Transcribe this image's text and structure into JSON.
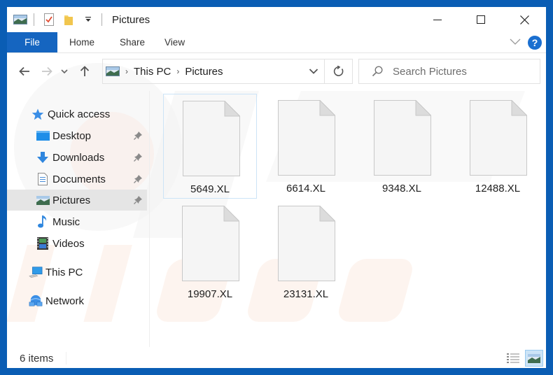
{
  "window": {
    "title": "Pictures",
    "controls": {
      "minimize": "minimize",
      "maximize": "maximize",
      "close": "close"
    }
  },
  "quick_access_toolbar": {
    "icons": [
      "pictures-icon",
      "properties-icon",
      "new-folder-icon",
      "customize-dropdown-icon"
    ]
  },
  "ribbon": {
    "tabs": [
      {
        "label": "File",
        "active": true
      },
      {
        "label": "Home"
      },
      {
        "label": "Share"
      },
      {
        "label": "View"
      }
    ],
    "expand_icon": "chevron-down-icon",
    "help_label": "?"
  },
  "navbar": {
    "back": "back-arrow-icon",
    "forward": "forward-arrow-icon",
    "recent": "recent-locations-icon",
    "up": "up-arrow-icon",
    "breadcrumb": [
      "This PC",
      "Pictures"
    ],
    "search_placeholder": "Search Pictures"
  },
  "sidebar": {
    "items": [
      {
        "label": "Quick access",
        "icon": "star-icon",
        "pinned": false,
        "selected": false
      },
      {
        "label": "Desktop",
        "icon": "desktop-icon",
        "pinned": true,
        "selected": false
      },
      {
        "label": "Downloads",
        "icon": "download-icon",
        "pinned": true,
        "selected": false
      },
      {
        "label": "Documents",
        "icon": "document-icon",
        "pinned": true,
        "selected": false
      },
      {
        "label": "Pictures",
        "icon": "pictures-icon",
        "pinned": true,
        "selected": true
      },
      {
        "label": "Music",
        "icon": "music-icon",
        "pinned": false,
        "selected": false
      },
      {
        "label": "Videos",
        "icon": "videos-icon",
        "pinned": false,
        "selected": false
      },
      {
        "label": "This PC",
        "icon": "computer-icon",
        "pinned": false,
        "selected": false
      },
      {
        "label": "Network",
        "icon": "network-icon",
        "pinned": false,
        "selected": false
      }
    ]
  },
  "files": [
    {
      "name": "5649.XL",
      "selected": true
    },
    {
      "name": "6614.XL",
      "selected": false
    },
    {
      "name": "9348.XL",
      "selected": false
    },
    {
      "name": "12488.XL",
      "selected": false
    },
    {
      "name": "19907.XL",
      "selected": false
    },
    {
      "name": "23131.XL",
      "selected": false
    }
  ],
  "statusbar": {
    "item_count": "6 items",
    "view_modes": [
      "details-view",
      "large-icons-view"
    ],
    "active_view": "large-icons-view"
  },
  "colors": {
    "accent": "#1565c0",
    "frame": "#0a5db4",
    "selection": "#cce4f7",
    "sidebar_selected": "#e5e5e5"
  }
}
